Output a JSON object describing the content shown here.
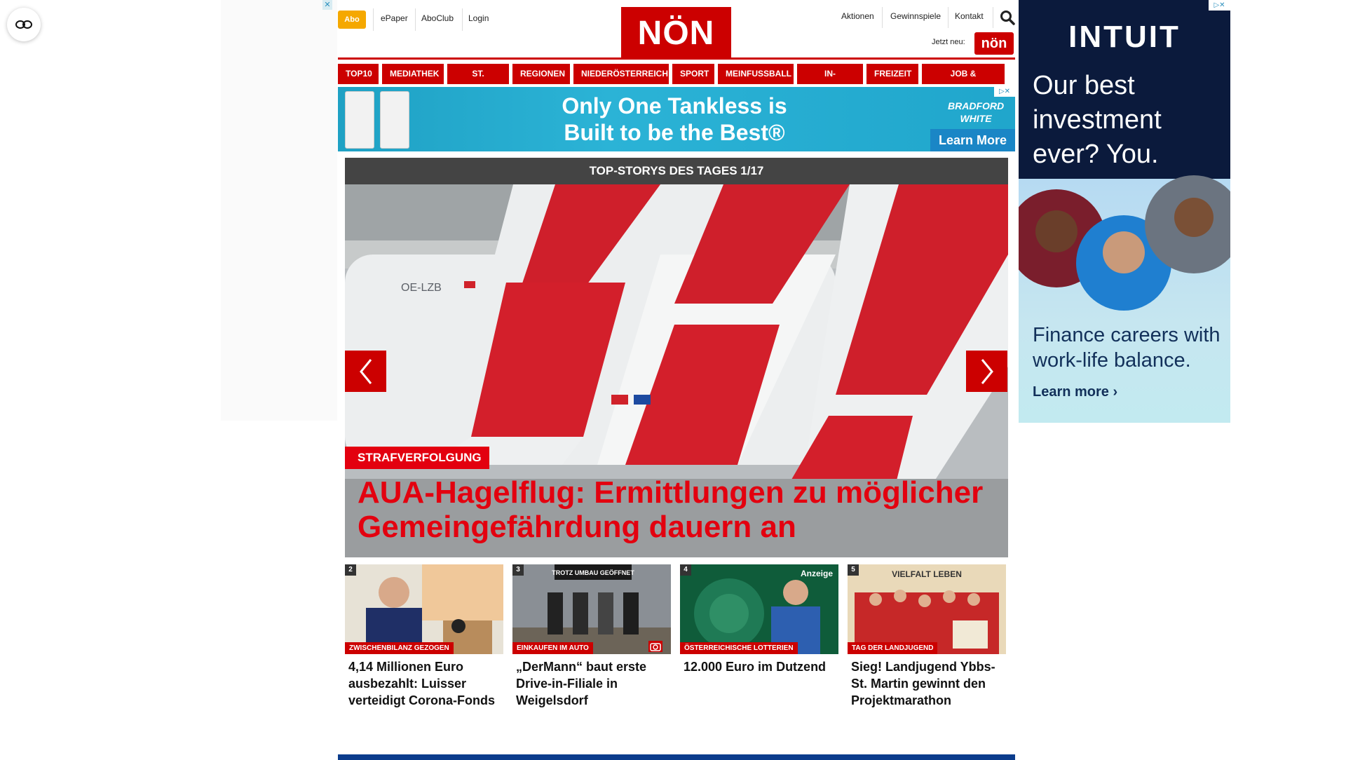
{
  "header": {
    "abo_label": "Abo",
    "left_links": [
      "ePaper",
      "AboClub",
      "Login"
    ],
    "logo_text": "NÖN",
    "right_links": [
      "Aktionen",
      "Gewinnspiele",
      "Kontakt"
    ],
    "jetzt_neu": "Jetzt neu:",
    "promo_badge": "nön",
    "ad_close": "✕"
  },
  "nav": {
    "items": [
      "TOP10",
      "MEDIATHEK",
      "ST. PÖLTEN",
      "REGIONEN",
      "NIEDERÖSTERREICH",
      "SPORT",
      "MEINFUSSBALL",
      "IN-AUSLAND",
      "FREIZEIT",
      "JOB & KARRIERE"
    ]
  },
  "banner_ad": {
    "line1": "Only One Tankless is",
    "line2": "Built to be the Best®",
    "brand": "BRADFORD WHITE",
    "cta": "Learn More",
    "close": "▷✕"
  },
  "slider": {
    "header": "TOP-STORYS DES TAGES 1/17",
    "kicker": "STRAFVERFOLGUNG",
    "title": "AUA-Hagelflug: Ermittlungen zu möglicher Gemeingefährdung dauern an",
    "plane_reg": "OE-LZB"
  },
  "cards": [
    {
      "num": "2",
      "tag": "ZWISCHENBILANZ GEZOGEN",
      "title": "4,14 Millionen Euro ausbezahlt: Luisser verteidigt Corona-Fonds",
      "anzeige": ""
    },
    {
      "num": "3",
      "tag": "EINKAUFEN IM AUTO",
      "title": "„DerMann“ baut erste Drive-in-Filiale in Weigelsdorf",
      "anzeige": "",
      "sign": "TROTZ UMBAU GEÖFFNET"
    },
    {
      "num": "4",
      "tag": "ÖSTERREICHISCHE LOTTERIEN",
      "title": "12.000 Euro im Dutzend",
      "anzeige": "Anzeige"
    },
    {
      "num": "5",
      "tag": "TAG DER LANDJUGEND",
      "title": "Sieg! Landjugend Ybbs-St. Martin gewinnt den Projektmarathon",
      "anzeige": "",
      "sign": "VIELFALT LEBEN"
    }
  ],
  "right_ad": {
    "logo": "INTUIT",
    "headline": "Our best investment ever? You.",
    "sub": "Finance careers with work-life balance.",
    "cta": "Learn more ›",
    "close": "▷✕"
  },
  "colors": {
    "brand_red": "#cc0000",
    "abo_orange": "#f5a800",
    "slider_header": "#444444",
    "banner_blue": "#1fa1c4",
    "intuit_navy": "#0b1a3c"
  },
  "icons": [
    "closed-captions-icon",
    "search-icon",
    "chevron-left-icon",
    "chevron-right-icon",
    "camera-icon"
  ]
}
